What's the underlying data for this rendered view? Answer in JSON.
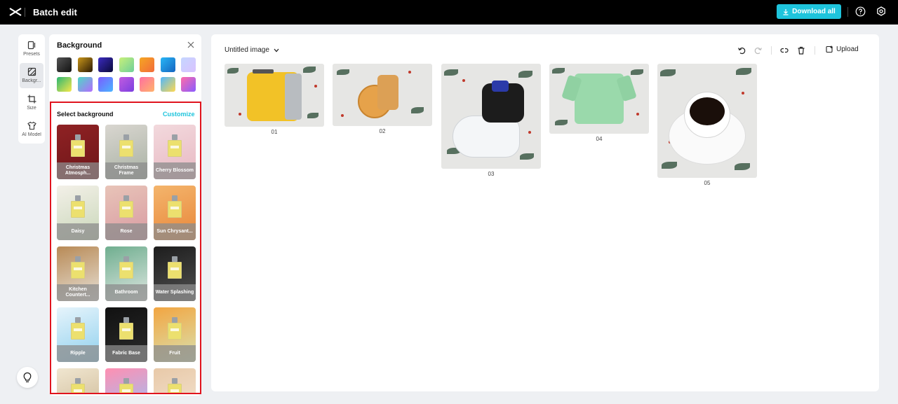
{
  "topbar": {
    "title": "Batch edit",
    "download_label": "Download all",
    "accent": "#1ec4dc"
  },
  "toolrail": {
    "items": [
      {
        "label": "Presets",
        "icon": "presets-icon"
      },
      {
        "label": "Backgr...",
        "icon": "background-icon",
        "active": true
      },
      {
        "label": "Size",
        "icon": "crop-icon"
      },
      {
        "label": "AI Model",
        "icon": "shirt-icon"
      }
    ]
  },
  "panel": {
    "title": "Background",
    "swatches": [
      "linear-gradient(135deg,#555,#111)",
      "linear-gradient(135deg,#c9961a,#2b1a05)",
      "linear-gradient(135deg,#3b2bbf,#0a0a3a)",
      "linear-gradient(135deg,#c8f07a,#6ecf9a)",
      "linear-gradient(135deg,#f5a623,#f26b3a)",
      "linear-gradient(135deg,#29b6f6,#1565c0)",
      "linear-gradient(135deg,#c5d6ff,#d9c2ff)",
      "linear-gradient(135deg,#2bb673,#f7e84a)",
      "linear-gradient(135deg,#4dd9c5,#b36bff)",
      "linear-gradient(135deg,#7b5cff,#4ab5ff)",
      "linear-gradient(135deg,#c15ce0,#7b3fe0)",
      "linear-gradient(135deg,#ff6fa0,#ffb36b)",
      "linear-gradient(135deg,#4fb7ff,#ffd84f)",
      "linear-gradient(135deg,#ff6ba8,#8a5cff)"
    ],
    "select_label": "Select background",
    "customize_label": "Customize",
    "backgrounds": [
      {
        "name": "Christmas Atmosph...",
        "bg": "linear-gradient(160deg,#8f2224,#6e1518)"
      },
      {
        "name": "Christmas Frame",
        "bg": "linear-gradient(160deg,#d9d6d0,#a8b1a3)"
      },
      {
        "name": "Cherry Blossom",
        "bg": "linear-gradient(160deg,#f2d9dd,#e8b8c2)"
      },
      {
        "name": "Daisy",
        "bg": "linear-gradient(160deg,#f3f0e8,#c9d7b9)"
      },
      {
        "name": "Rose",
        "bg": "linear-gradient(160deg,#e8c4b8,#d89aa2)"
      },
      {
        "name": "Sun Chrysant...",
        "bg": "linear-gradient(160deg,#f4b56c,#e8863a)"
      },
      {
        "name": "Kitchen Countert...",
        "bg": "linear-gradient(160deg,#b88a56,#e8e2d8)"
      },
      {
        "name": "Bathroom",
        "bg": "linear-gradient(160deg,#6fae8f,#dfe7e2)"
      },
      {
        "name": "Water Splashing",
        "bg": "linear-gradient(160deg,#1d1d1d,#505050)"
      },
      {
        "name": "Ripple",
        "bg": "linear-gradient(160deg,#e6f4fb,#8fd0ee)"
      },
      {
        "name": "Fabric Base",
        "bg": "linear-gradient(160deg,#111,#2c2c2c)"
      },
      {
        "name": "Fruit",
        "bg": "linear-gradient(160deg,#f2a541,#d9e2b0)"
      },
      {
        "name": "",
        "bg": "linear-gradient(160deg,#f0e6d0,#c9b38f)"
      },
      {
        "name": "",
        "bg": "linear-gradient(160deg,#ff8fb1,#8fc7ff)"
      },
      {
        "name": "",
        "bg": "linear-gradient(160deg,#e8c9a8,#f5e6d6)"
      }
    ]
  },
  "canvas": {
    "title": "Untitled image",
    "upload_label": "Upload",
    "images": [
      {
        "num": "01",
        "subject": "toaster"
      },
      {
        "num": "02",
        "subject": "cookies"
      },
      {
        "num": "03",
        "subject": "sneaker"
      },
      {
        "num": "04",
        "subject": "shirt"
      },
      {
        "num": "05",
        "subject": "coffee"
      }
    ]
  }
}
